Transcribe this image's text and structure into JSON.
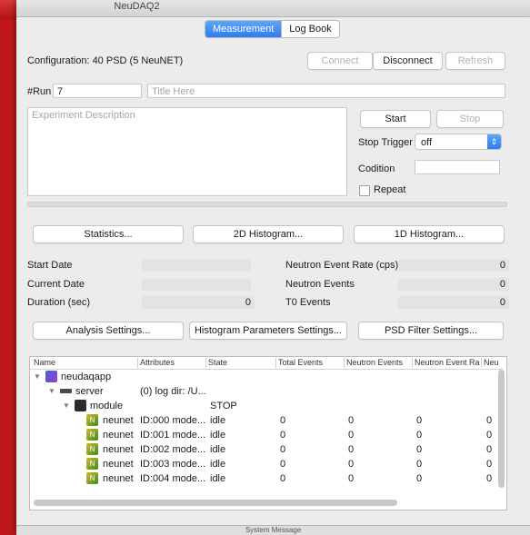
{
  "window": {
    "title": "NeuDAQ2",
    "bottom_title": "System Message"
  },
  "tabs": [
    {
      "label": "Measurement",
      "active": true
    },
    {
      "label": "Log Book",
      "active": false
    }
  ],
  "config": {
    "label": "Configuration:",
    "value": "40 PSD (5 NeuNET)"
  },
  "connection": {
    "connect": "Connect",
    "disconnect": "Disconnect",
    "refresh": "Refresh"
  },
  "run": {
    "label": "#Run",
    "number": "7",
    "title_placeholder": "Title Here",
    "description_placeholder": "Experiment Description"
  },
  "control": {
    "start": "Start",
    "stop": "Stop",
    "stop_trigger_label": "Stop Trigger",
    "stop_trigger_value": "off",
    "condition_label": "Codition",
    "condition_value": "",
    "repeat_label": "Repeat",
    "repeat_checked": false
  },
  "views": {
    "statistics": "Statistics...",
    "hist2d": "2D Histogram...",
    "hist1d": "1D Histogram..."
  },
  "stats": {
    "start_date_label": "Start Date",
    "start_date": "",
    "current_date_label": "Current Date",
    "current_date": "",
    "duration_label": "Duration (sec)",
    "duration": "0",
    "rate_label": "Neutron Event Rate (cps)",
    "rate": "0",
    "neutron_events_label": "Neutron Events",
    "neutron_events": "0",
    "t0_label": "T0 Events",
    "t0": "0"
  },
  "settings": {
    "analysis": "Analysis Settings...",
    "histogram": "Histogram Parameters Settings...",
    "psd": "PSD Filter Settings..."
  },
  "tree": {
    "headers": [
      "Name",
      "Attributes",
      "State",
      "Total Events",
      "Neutron Events",
      "Neutron Event Ra",
      "Neu"
    ],
    "app": "neudaqapp",
    "server": {
      "name": "server",
      "attributes": "(0) log dir: /U...",
      "state": ""
    },
    "module": {
      "name": "module",
      "attributes": "",
      "state": "STOP"
    },
    "rows": [
      {
        "name": "neunet",
        "attributes": "ID:000 mode...",
        "state": "idle",
        "total": "0",
        "neutron": "0",
        "rate": "0",
        "extra": "0"
      },
      {
        "name": "neunet",
        "attributes": "ID:001 mode...",
        "state": "idle",
        "total": "0",
        "neutron": "0",
        "rate": "0",
        "extra": "0"
      },
      {
        "name": "neunet",
        "attributes": "ID:002 mode...",
        "state": "idle",
        "total": "0",
        "neutron": "0",
        "rate": "0",
        "extra": "0"
      },
      {
        "name": "neunet",
        "attributes": "ID:003 mode...",
        "state": "idle",
        "total": "0",
        "neutron": "0",
        "rate": "0",
        "extra": "0"
      },
      {
        "name": "neunet",
        "attributes": "ID:004 mode...",
        "state": "idle",
        "total": "0",
        "neutron": "0",
        "rate": "0",
        "extra": "0"
      }
    ]
  },
  "colors": {
    "accent": "#2d7cf0",
    "background_red": "#c0181a"
  }
}
